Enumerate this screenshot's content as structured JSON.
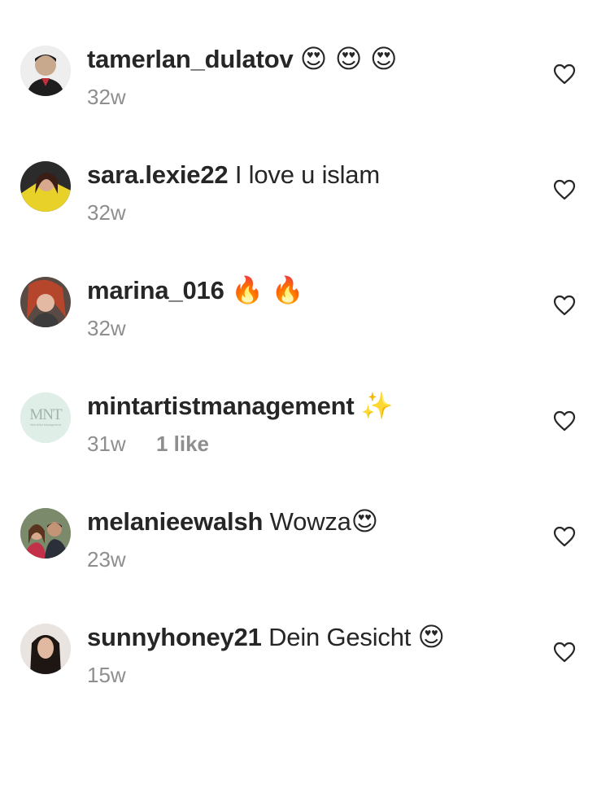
{
  "comments": [
    {
      "username": "tamerlan_dulatov",
      "text": "",
      "emoji": "😍 😍 😍",
      "time": "32w",
      "likes": "",
      "avatar": "avatar-man-dark"
    },
    {
      "username": "sara.lexie22",
      "text": "I love u islam",
      "emoji": "",
      "time": "32w",
      "likes": "",
      "avatar": "avatar-woman-yellow"
    },
    {
      "username": "marina_016",
      "text": "",
      "emoji": "🔥 🔥",
      "time": "32w",
      "likes": "",
      "avatar": "avatar-woman-red-hair"
    },
    {
      "username": "mintartistmanagement",
      "text": "",
      "emoji": "✨",
      "time": "31w",
      "likes": "1 like",
      "avatar": "avatar-mnt-logo"
    },
    {
      "username": "melanieewalsh",
      "text": "Wowza",
      "emoji": "😍",
      "time": "23w",
      "likes": "",
      "avatar": "avatar-couple"
    },
    {
      "username": "sunnyhoney21",
      "text": "Dein Gesicht",
      "emoji": "😍",
      "time": "15w",
      "likes": "",
      "avatar": "avatar-woman-dark-hair"
    }
  ],
  "mnt_logo_text": "MNT",
  "mnt_logo_subtitle": "Mint Artist Management",
  "colors": {
    "username": "#262626",
    "meta": "#8e8e8e",
    "heart_stroke": "#262626",
    "mint_avatar_bg": "#dfeee6"
  }
}
